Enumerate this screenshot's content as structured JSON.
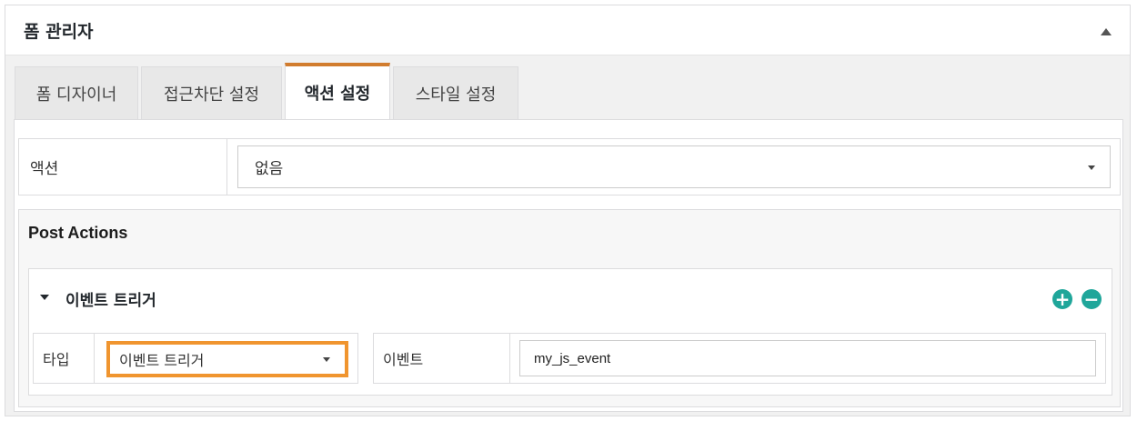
{
  "panel": {
    "title": "폼 관리자",
    "toggle_icon": "triangle-up-icon"
  },
  "tabs": [
    {
      "label": "폼 디자이너",
      "active": false
    },
    {
      "label": "접근차단 설정",
      "active": false
    },
    {
      "label": "액션 설정",
      "active": true
    },
    {
      "label": "스타일 설정",
      "active": false
    }
  ],
  "action": {
    "label": "액션",
    "selected": "없음"
  },
  "post_actions": {
    "title": "Post Actions",
    "item": {
      "title": "이벤트 트리거",
      "add_icon": "plus-circle-icon",
      "remove_icon": "minus-circle-icon",
      "type_label": "타입",
      "type_value": "이벤트 트리거",
      "event_label": "이벤트",
      "event_value": "my_js_event"
    }
  },
  "colors": {
    "accent_tab": "#d17c2e",
    "highlight_border": "#f0952f",
    "icon_teal": "#1fa69a"
  }
}
